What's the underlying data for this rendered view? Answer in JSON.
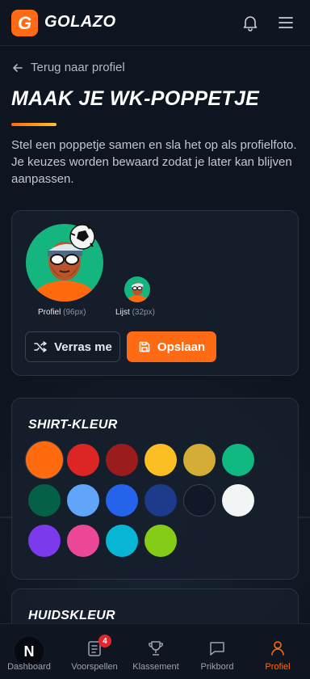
{
  "header": {
    "brand": "GOLAZO",
    "brand_initial": "G",
    "bell_icon": "bell-icon",
    "menu_icon": "menu-icon"
  },
  "back_link": {
    "label": "Terug naar profiel"
  },
  "page": {
    "title": "MAAK JE WK-POPPETJE",
    "intro": "Stel een poppetje samen en sla het op als profielfoto. Je keuzes worden bewaard zodat je later kan blijven aanpassen."
  },
  "preview": {
    "profile_label": "Profiel",
    "profile_size": "(96px)",
    "list_label": "Lijst",
    "list_size": "(32px)",
    "randomize_label": "Verras me",
    "save_label": "Opslaan"
  },
  "shirt": {
    "title": "SHIRT-KLEUR",
    "selected_index": 0,
    "colors": [
      "#ff6a0f",
      "#dc2626",
      "#9b1c1c",
      "#fbbf24",
      "#d4ad36",
      "#10b981",
      "#046046",
      "#60a5fa",
      "#2563eb",
      "#1e3a8a",
      "#111827",
      "#f3f4f6",
      "#7c3aed",
      "#ec4899",
      "#06b6d4",
      "#84cc16"
    ]
  },
  "skin": {
    "title": "HUIDSKLEUR"
  },
  "bottom_nav": {
    "items": [
      {
        "label": "Dashboard",
        "icon": "logo-n-icon"
      },
      {
        "label": "Voorspellen",
        "icon": "clipboard-icon",
        "badge": "4"
      },
      {
        "label": "Klassement",
        "icon": "trophy-icon"
      },
      {
        "label": "Prikbord",
        "icon": "chat-icon"
      },
      {
        "label": "Profiel",
        "icon": "user-icon",
        "active": true
      }
    ]
  },
  "colors": {
    "accent": "#ff6a14",
    "background": "#0e1420",
    "card": "#161e2b"
  }
}
